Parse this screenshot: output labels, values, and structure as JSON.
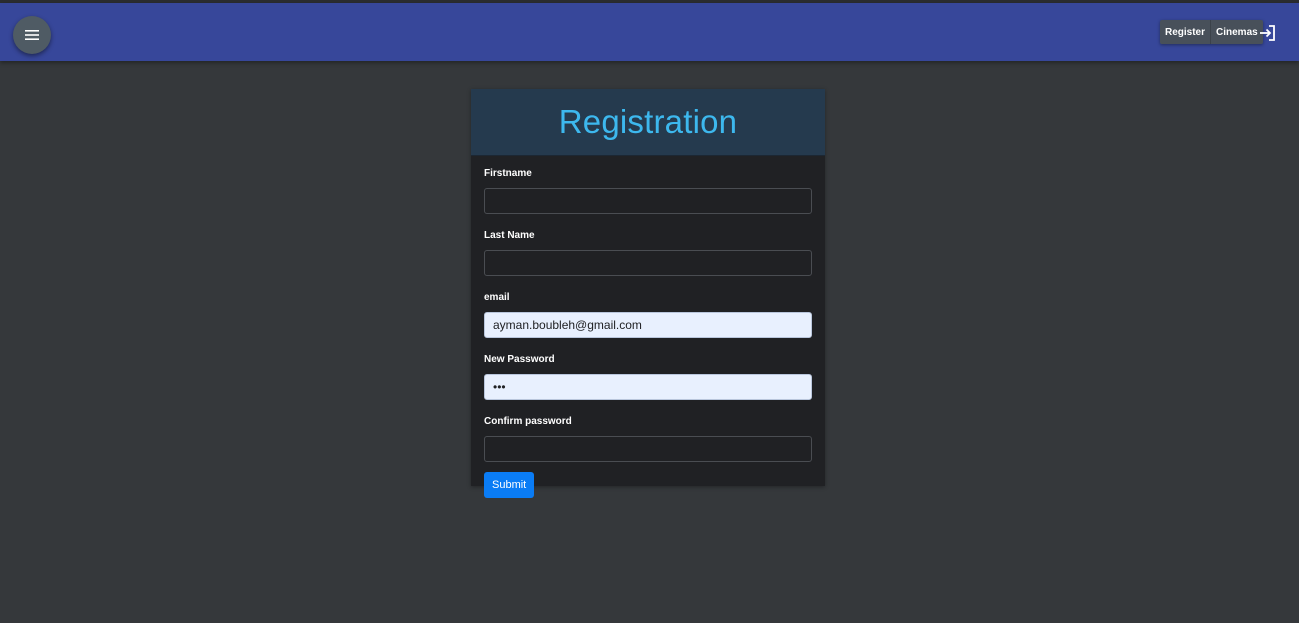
{
  "navbar": {
    "menu_icon": "hamburger-menu-icon",
    "buttons": [
      "Register",
      "Cinemas"
    ],
    "login_icon": "login-arrow-icon",
    "background_color": "#37479a"
  },
  "form": {
    "title": "Registration",
    "title_color": "#3db8ee",
    "fields": {
      "firstname": {
        "label": "Firstname",
        "value": ""
      },
      "last_name": {
        "label": "Last Name",
        "value": ""
      },
      "email": {
        "label": "email",
        "value": "ayman.boubleh@gmail.com"
      },
      "new_password": {
        "label": "New Password",
        "value": "•••"
      },
      "confirm_password": {
        "label": "Confirm password",
        "value": ""
      }
    },
    "submit_label": "Submit",
    "submit_color": "#0a7cf5"
  }
}
